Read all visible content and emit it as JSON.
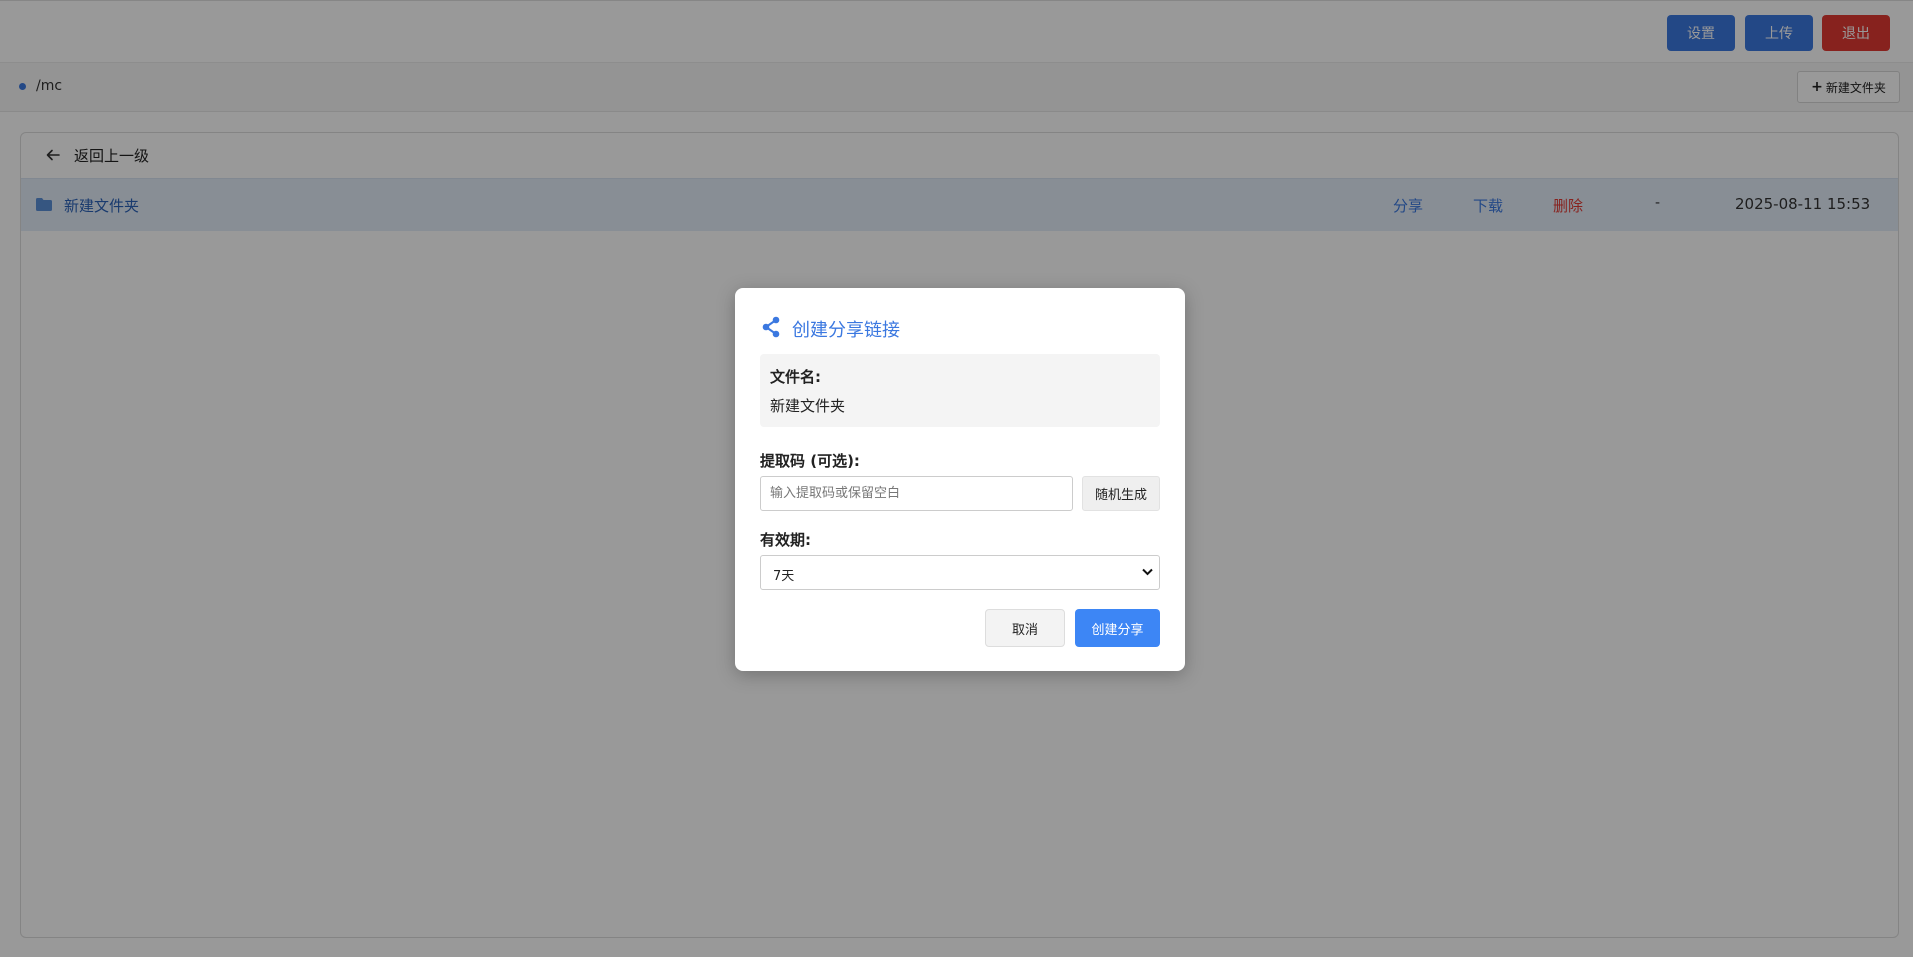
{
  "header": {
    "settings_label": "设置",
    "upload_label": "上传",
    "logout_label": "退出"
  },
  "pathbar": {
    "path": "/mc",
    "new_folder_label": "新建文件夹"
  },
  "file_list": {
    "back_label": "返回上一级",
    "rows": [
      {
        "name": "新建文件夹",
        "share_label": "分享",
        "download_label": "下载",
        "delete_label": "删除",
        "size": "-",
        "modified": "2025-08-11 15:53"
      }
    ]
  },
  "share_dialog": {
    "title": "创建分享链接",
    "filename_label": "文件名:",
    "filename_value": "新建文件夹",
    "code_label": "提取码 (可选):",
    "code_placeholder": "输入提取码或保留空白",
    "random_label": "随机生成",
    "expire_label": "有效期:",
    "expire_value": "7天",
    "cancel_label": "取消",
    "create_label": "创建分享"
  },
  "colors": {
    "primary": "#3b78e0",
    "danger": "#e23a32",
    "selected_row": "#e3edf9"
  }
}
